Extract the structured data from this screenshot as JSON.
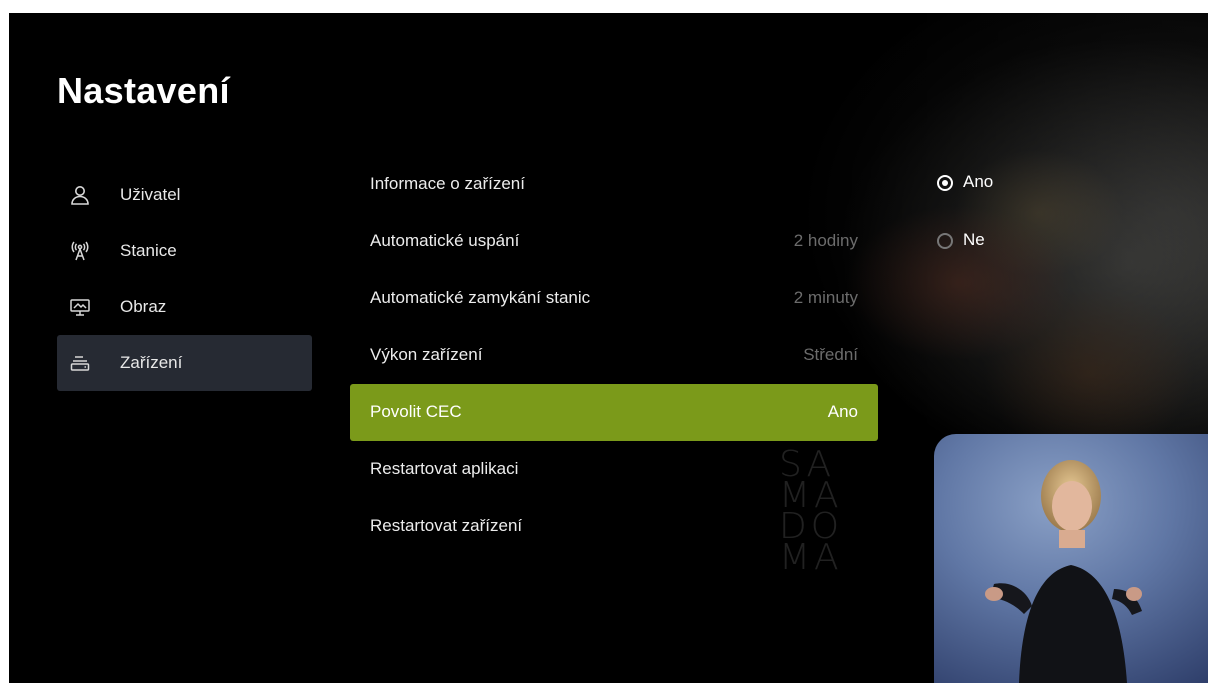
{
  "title": "Nastavení",
  "sidebar": {
    "items": [
      {
        "label": "Uživatel",
        "icon": "user-icon"
      },
      {
        "label": "Stanice",
        "icon": "antenna-icon"
      },
      {
        "label": "Obraz",
        "icon": "screen-icon"
      },
      {
        "label": "Zařízení",
        "icon": "device-icon",
        "active": true
      }
    ]
  },
  "settings": {
    "rows": [
      {
        "label": "Informace o zařízení",
        "value": ""
      },
      {
        "label": "Automatické uspání",
        "value": "2 hodiny"
      },
      {
        "label": "Automatické zamykání stanic",
        "value": "2 minuty"
      },
      {
        "label": "Výkon zařízení",
        "value": "Střední"
      },
      {
        "label": "Povolit CEC",
        "value": "Ano",
        "selected": true
      },
      {
        "label": "Restartovat aplikaci",
        "value": ""
      },
      {
        "label": "Restartovat zařízení",
        "value": ""
      }
    ]
  },
  "options": [
    {
      "label": "Ano",
      "checked": true
    },
    {
      "label": "Ne",
      "checked": false
    }
  ],
  "watermark": [
    "SA",
    "MA",
    "DO",
    "MA"
  ],
  "colors": {
    "accent": "#7b9a1a",
    "sidebar_active": "#262a33",
    "background": "#000000",
    "muted_value": "#6c6c6c"
  }
}
